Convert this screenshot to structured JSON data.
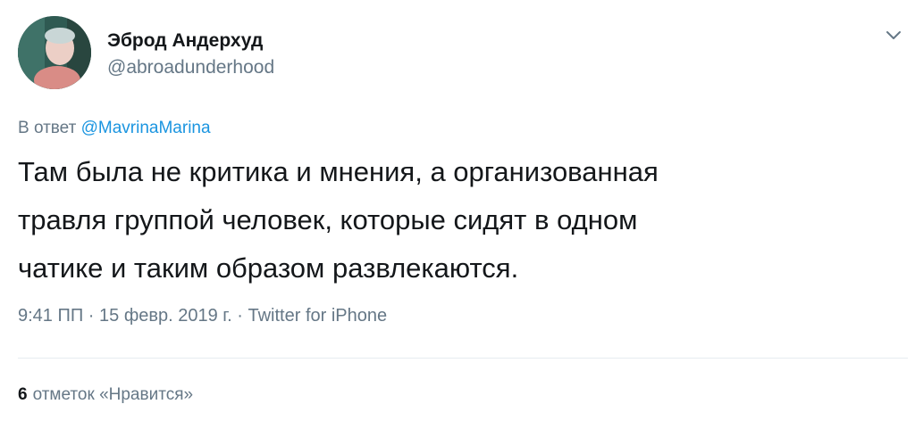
{
  "author": {
    "display_name": "Эброд Андерхуд",
    "handle": "@abroadunderhood"
  },
  "reply": {
    "prefix": "В ответ",
    "mention": "@MavrinaMarina"
  },
  "tweet": {
    "line1": "Там была не критика и мнения, а организованная",
    "line2": "травля группой человек, которые сидят в одном",
    "line3": "чатике и таким образом развлекаются."
  },
  "meta": {
    "time": "9:41 ПП",
    "sep1": " · ",
    "date": "15 февр. 2019 г.",
    "sep2": " · ",
    "source": "Twitter for iPhone"
  },
  "stats": {
    "likes_count": "6",
    "likes_label": "отметок «Нравится»"
  },
  "icons": {
    "menu": "chevron-down-icon"
  },
  "colors": {
    "text": "#14171a",
    "secondary": "#657786",
    "link": "#1b95e0",
    "divider": "#e6ecf0"
  }
}
